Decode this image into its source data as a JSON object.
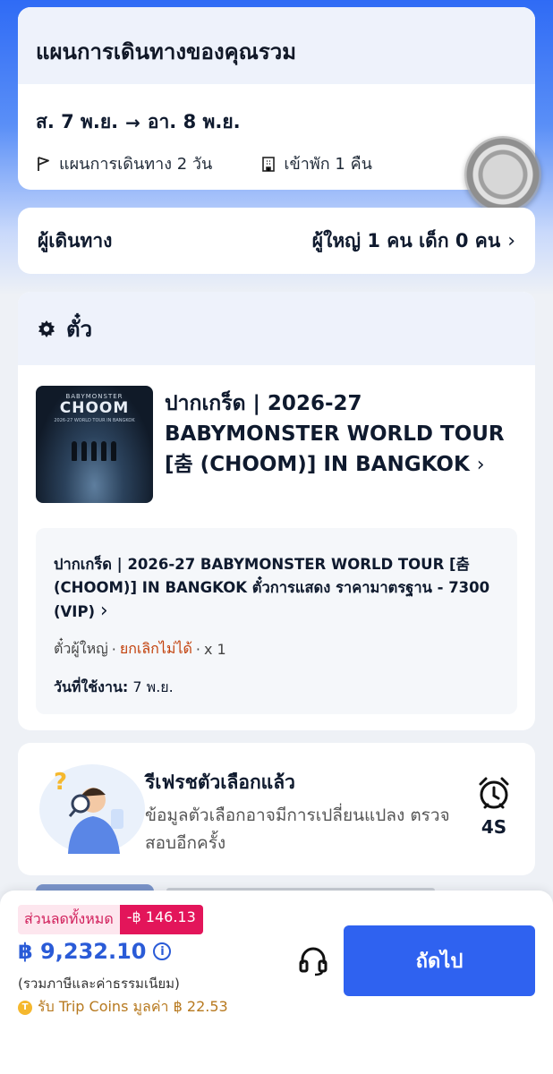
{
  "trip": {
    "title": "แผนการเดินทางของคุณรวม",
    "date_from": "ส. 7 พ.ย.",
    "arrow": "→",
    "date_to": "อา. 8 พ.ย.",
    "itinerary": "แผนการเดินทาง 2 วัน",
    "stay": "เข้าพัก 1 คืน"
  },
  "travelers": {
    "label": "ผู้เดินทาง",
    "value": "ผู้ใหญ่ 1 คน เด็ก 0 คน"
  },
  "ticket": {
    "section_title": "ตั๋ว",
    "thumb_top": "BABYMONSTER",
    "thumb_title": "CHOOM",
    "thumb_sub": "2026-27 WORLD TOUR\nIN BANGKOK",
    "event_name": "ปากเกร็ด | 2026-27 BABYMONSTER WORLD TOUR [춤 (CHOOM)] IN BANGKOK",
    "detail_title": "ปากเกร็ด | 2026-27 BABYMONSTER WORLD TOUR [춤 (CHOOM)] IN BANGKOK ตั๋วการแสดง ราคามาตรฐาน - 7300 (VIP)",
    "ticket_type": "ตั๋วผู้ใหญ่",
    "sep1": "·",
    "non_refundable": "ยกเลิกไม่ได้",
    "sep2": "·",
    "quantity": "x 1",
    "use_date_label": "วันที่ใช้งาน:",
    "use_date": "7 พ.ย."
  },
  "refresh": {
    "title": "รีเฟรชตัวเลือกแล้ว",
    "description": "ข้อมูลตัวเลือกอาจมีการเปลี่ยนแปลง ตรวจสอบอีกครั้ง",
    "countdown": "4S"
  },
  "bottom": {
    "discount_label": "ส่วนลดทั้งหมด",
    "discount_value": "-฿ 146.13",
    "total": "฿ 9,232.10",
    "tax_note": "(รวมภาษีและค่าธรรมเนียม)",
    "coins": "รับ Trip Coins มูลค่า ฿ 22.53",
    "next_label": "ถัดไป"
  }
}
